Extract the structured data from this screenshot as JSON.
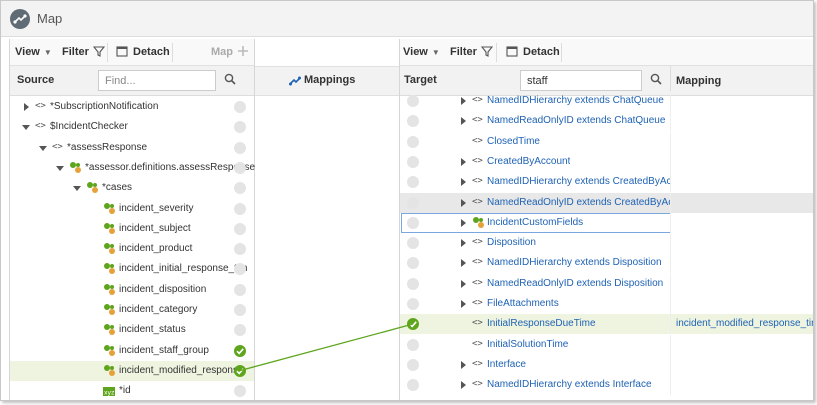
{
  "app": {
    "title": "Map"
  },
  "source": {
    "toolbar": {
      "view": "View",
      "filter": "Filter",
      "detach": "Detach",
      "map": "Map"
    },
    "header": "Source",
    "search_placeholder": "Find...",
    "rows": [
      {
        "label": "*SubscriptionNotification",
        "indent": 0,
        "expander": "collapsed",
        "kind": "code",
        "status": "none"
      },
      {
        "label": "$IncidentChecker",
        "indent": 0,
        "expander": "expanded",
        "kind": "code",
        "status": "none"
      },
      {
        "label": "*assessResponse",
        "indent": 1,
        "expander": "expanded",
        "kind": "code",
        "status": "none"
      },
      {
        "label": "*assessor.definitions.assessResponse",
        "indent": 2,
        "expander": "expanded",
        "kind": "element",
        "status": "none"
      },
      {
        "label": "*cases",
        "indent": 3,
        "expander": "expanded",
        "kind": "element",
        "status": "none"
      },
      {
        "label": "incident_severity",
        "indent": 4,
        "expander": "none",
        "kind": "element",
        "status": "none"
      },
      {
        "label": "incident_subject",
        "indent": 4,
        "expander": "none",
        "kind": "element",
        "status": "none"
      },
      {
        "label": "incident_product",
        "indent": 4,
        "expander": "none",
        "kind": "element",
        "status": "none"
      },
      {
        "label": "incident_initial_response_tim",
        "indent": 4,
        "expander": "none",
        "kind": "element",
        "status": "none"
      },
      {
        "label": "incident_disposition",
        "indent": 4,
        "expander": "none",
        "kind": "element",
        "status": "none"
      },
      {
        "label": "incident_category",
        "indent": 4,
        "expander": "none",
        "kind": "element",
        "status": "none"
      },
      {
        "label": "incident_status",
        "indent": 4,
        "expander": "none",
        "kind": "element",
        "status": "none"
      },
      {
        "label": "incident_staff_group",
        "indent": 4,
        "expander": "none",
        "kind": "element",
        "status": "mapped"
      },
      {
        "label": "incident_modified_response",
        "indent": 4,
        "expander": "none",
        "kind": "element",
        "status": "mapped",
        "selected": true
      },
      {
        "label": "*id",
        "indent": 4,
        "expander": "none",
        "kind": "xyz",
        "status": "none"
      }
    ]
  },
  "middle": {
    "header": "Mappings"
  },
  "target": {
    "toolbar": {
      "view": "View",
      "filter": "Filter",
      "detach": "Detach"
    },
    "header": "Target",
    "search_value": "staff",
    "mapping_header": "Mapping",
    "rows": [
      {
        "label": "NamedIDHierarchy extends ChatQueue",
        "expander": "collapsed",
        "kind": "code",
        "status": "none",
        "mapping": ""
      },
      {
        "label": "NamedReadOnlyID extends ChatQueue",
        "expander": "collapsed",
        "kind": "code",
        "status": "none",
        "mapping": ""
      },
      {
        "label": "ClosedTime",
        "expander": "none",
        "kind": "code",
        "status": "none",
        "mapping": ""
      },
      {
        "label": "CreatedByAccount",
        "expander": "collapsed",
        "kind": "code",
        "status": "none",
        "mapping": ""
      },
      {
        "label": "NamedIDHierarchy extends CreatedByAccour",
        "expander": "collapsed",
        "kind": "code",
        "status": "none",
        "mapping": ""
      },
      {
        "label": "NamedReadOnlyID extends CreatedByAccour",
        "expander": "collapsed",
        "kind": "code",
        "status": "none",
        "mapping": "",
        "highlight": true
      },
      {
        "label": "IncidentCustomFields",
        "expander": "collapsed",
        "kind": "element",
        "status": "none",
        "mapping": "",
        "focused": true
      },
      {
        "label": "Disposition",
        "expander": "collapsed",
        "kind": "code",
        "status": "none",
        "mapping": ""
      },
      {
        "label": "NamedIDHierarchy extends Disposition",
        "expander": "collapsed",
        "kind": "code",
        "status": "none",
        "mapping": ""
      },
      {
        "label": "NamedReadOnlyID extends Disposition",
        "expander": "collapsed",
        "kind": "code",
        "status": "none",
        "mapping": ""
      },
      {
        "label": "FileAttachments",
        "expander": "collapsed",
        "kind": "code",
        "status": "none",
        "mapping": ""
      },
      {
        "label": "InitialResponseDueTime",
        "expander": "none",
        "kind": "code",
        "status": "mapped",
        "mapping": "incident_modified_response_time",
        "selected": true
      },
      {
        "label": "InitialSolutionTime",
        "expander": "none",
        "kind": "code",
        "status": "none",
        "mapping": ""
      },
      {
        "label": "Interface",
        "expander": "collapsed",
        "kind": "code",
        "status": "none",
        "mapping": ""
      },
      {
        "label": "NamedIDHierarchy extends Interface",
        "expander": "collapsed",
        "kind": "code",
        "status": "none",
        "mapping": ""
      }
    ]
  },
  "colors": {
    "accent": "#5ea51d",
    "link": "#1e62b4"
  },
  "icons": [
    "app-map-icon",
    "filter-icon",
    "detach-icon",
    "search-icon",
    "add-mapping-icon",
    "expand-icon",
    "element-icon",
    "code-brackets-icon",
    "status-circle-icon",
    "mapped-check-icon"
  ]
}
